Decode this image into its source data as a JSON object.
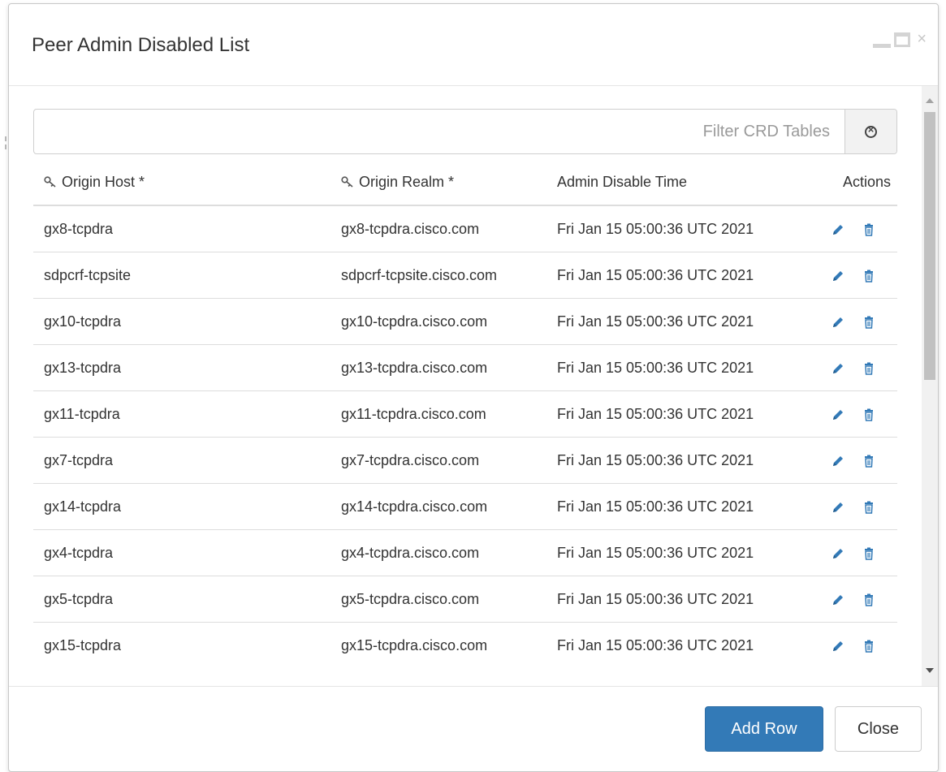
{
  "dialog": {
    "title": "Peer Admin Disabled List"
  },
  "filter": {
    "placeholder": "Filter CRD Tables",
    "value": ""
  },
  "table": {
    "columns": [
      "Origin Host *",
      "Origin Realm *",
      "Admin Disable Time",
      "Actions"
    ],
    "rows": [
      [
        "gx8-tcpdra",
        "gx8-tcpdra.cisco.com",
        "Fri Jan 15 05:00:36 UTC 2021"
      ],
      [
        "sdpcrf-tcpsite",
        "sdpcrf-tcpsite.cisco.com",
        "Fri Jan 15 05:00:36 UTC 2021"
      ],
      [
        "gx10-tcpdra",
        "gx10-tcpdra.cisco.com",
        "Fri Jan 15 05:00:36 UTC 2021"
      ],
      [
        "gx13-tcpdra",
        "gx13-tcpdra.cisco.com",
        "Fri Jan 15 05:00:36 UTC 2021"
      ],
      [
        "gx11-tcpdra",
        "gx11-tcpdra.cisco.com",
        "Fri Jan 15 05:00:36 UTC 2021"
      ],
      [
        "gx7-tcpdra",
        "gx7-tcpdra.cisco.com",
        "Fri Jan 15 05:00:36 UTC 2021"
      ],
      [
        "gx14-tcpdra",
        "gx14-tcpdra.cisco.com",
        "Fri Jan 15 05:00:36 UTC 2021"
      ],
      [
        "gx4-tcpdra",
        "gx4-tcpdra.cisco.com",
        "Fri Jan 15 05:00:36 UTC 2021"
      ],
      [
        "gx5-tcpdra",
        "gx5-tcpdra.cisco.com",
        "Fri Jan 15 05:00:36 UTC 2021"
      ],
      [
        "gx15-tcpdra",
        "gx15-tcpdra.cisco.com",
        "Fri Jan 15 05:00:36 UTC 2021"
      ]
    ],
    "row_actions": [
      "edit-icon",
      "delete-icon"
    ]
  },
  "footer": {
    "add_row_label": "Add Row",
    "close_label": "Close"
  },
  "colors": {
    "primary": "#337ab7",
    "action_icon": "#337ab7",
    "border": "#dddddd"
  }
}
